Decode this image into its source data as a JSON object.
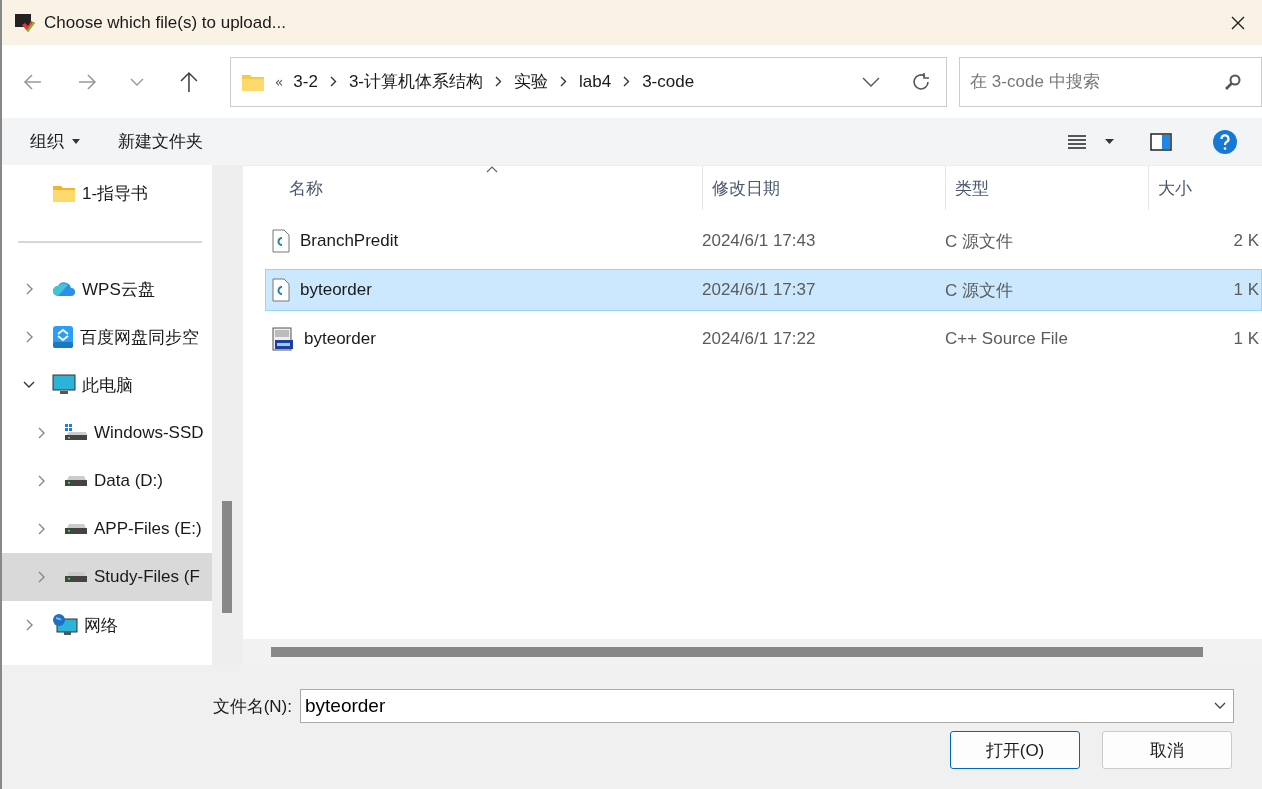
{
  "window": {
    "title": "Choose which file(s) to upload..."
  },
  "address_bar": {
    "overflow": "«",
    "crumbs": [
      "3-2",
      "3-计算机体系结构",
      "实验",
      "lab4",
      "3-code"
    ]
  },
  "search": {
    "placeholder": "在 3-code 中搜索"
  },
  "toolbar": {
    "organize": "组织",
    "new_folder": "新建文件夹"
  },
  "sidebar": {
    "items": [
      {
        "label": "1-指导书",
        "kind": "folder",
        "selected": false
      },
      {
        "label": "WPS云盘",
        "kind": "cloud",
        "expanded": false,
        "selected": false
      },
      {
        "label": "百度网盘同步空",
        "kind": "sync",
        "expanded": false,
        "selected": false
      },
      {
        "label": "此电脑",
        "kind": "pc",
        "expanded": true,
        "selected": false,
        "children": [
          {
            "label": "Windows-SSD",
            "kind": "system-drive",
            "expanded": false,
            "selected": false
          },
          {
            "label": "Data (D:)",
            "kind": "drive",
            "expanded": false,
            "selected": false
          },
          {
            "label": "APP-Files (E:)",
            "kind": "drive",
            "expanded": false,
            "selected": false
          },
          {
            "label": "Study-Files (F",
            "kind": "drive",
            "expanded": false,
            "selected": true
          }
        ]
      },
      {
        "label": "网络",
        "kind": "network",
        "expanded": false,
        "selected": false
      }
    ]
  },
  "table": {
    "columns": [
      "名称",
      "修改日期",
      "类型",
      "大小"
    ],
    "rows": [
      {
        "name": "BranchPredit",
        "kind": "c",
        "modified": "2024/6/1 17:43",
        "type": "C 源文件",
        "size": "2 K",
        "selected": false
      },
      {
        "name": "byteorder",
        "kind": "c",
        "modified": "2024/6/1 17:37",
        "type": "C 源文件",
        "size": "1 K",
        "selected": true
      },
      {
        "name": "byteorder",
        "kind": "cpp",
        "modified": "2024/6/1 17:22",
        "type": "C++ Source File",
        "size": "1 K",
        "selected": false
      }
    ]
  },
  "filename": {
    "label": "文件名(N):",
    "value": "byteorder"
  },
  "buttons": [
    "打开(O)",
    "取消"
  ]
}
